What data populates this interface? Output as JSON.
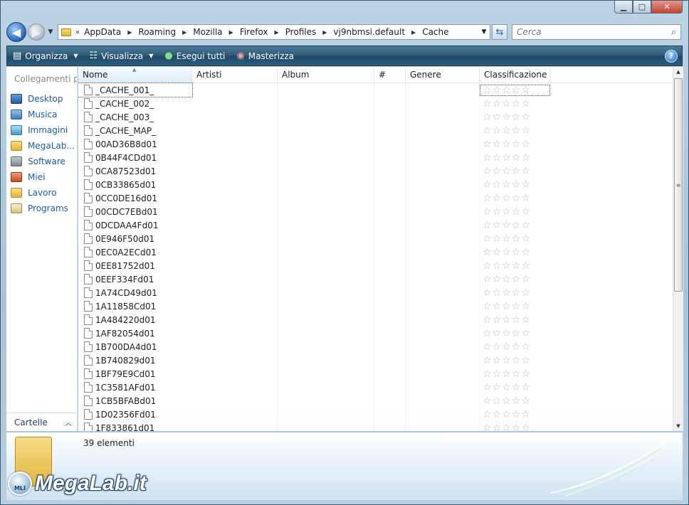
{
  "window": {
    "min_label": "▁",
    "max_label": "▢",
    "close_label": "✕"
  },
  "address": {
    "prefix": "«",
    "crumbs": [
      "AppData",
      "Roaming",
      "Mozilla",
      "Firefox",
      "Profiles",
      "vj9nbmsi.default",
      "Cache"
    ],
    "search_placeholder": "Cerca"
  },
  "toolbar": {
    "organize": "Organizza",
    "views": "Visualizza",
    "run_all": "Esegui tutti",
    "burn": "Masterizza",
    "help": "?"
  },
  "nav": {
    "title": "Collegamenti preferiti",
    "items": [
      {
        "label": "Desktop",
        "icon": "desktop-icon"
      },
      {
        "label": "Musica",
        "icon": "music-icon"
      },
      {
        "label": "Immagini",
        "icon": "pictures-icon"
      },
      {
        "label": "MegaLab...",
        "icon": "folder-icon"
      },
      {
        "label": "Software",
        "icon": "software-icon"
      },
      {
        "label": "Miei",
        "icon": "miei-icon"
      },
      {
        "label": "Lavoro",
        "icon": "folder-icon"
      },
      {
        "label": "Programs",
        "icon": "programs-icon"
      }
    ],
    "folders_label": "Cartelle"
  },
  "columns": [
    "Nome",
    "Artisti",
    "Album",
    "#",
    "Genere",
    "Classificazione"
  ],
  "files": [
    "_CACHE_001_",
    "_CACHE_002_",
    "_CACHE_003_",
    "_CACHE_MAP_",
    "00AD36B8d01",
    "0B44F4CDd01",
    "0CA87523d01",
    "0CB33865d01",
    "0CC0DE16d01",
    "00CDC7EBd01",
    "0DCDAA4Fd01",
    "0E946F50d01",
    "0EC0A2ECd01",
    "0EE81752d01",
    "0EEF334Fd01",
    "1A74CD49d01",
    "1A11858Cd01",
    "1A484220d01",
    "1AF82054d01",
    "1B700DA4d01",
    "1B740829d01",
    "1BF79E9Cd01",
    "1C3581AFd01",
    "1CB5BFABd01",
    "1D02356Fd01",
    "1F833861d01"
  ],
  "rating_stars": "☆☆☆☆☆",
  "status": {
    "count": "39 elementi"
  },
  "logo": {
    "badge": "MLI",
    "text": "MegaLab.it"
  }
}
